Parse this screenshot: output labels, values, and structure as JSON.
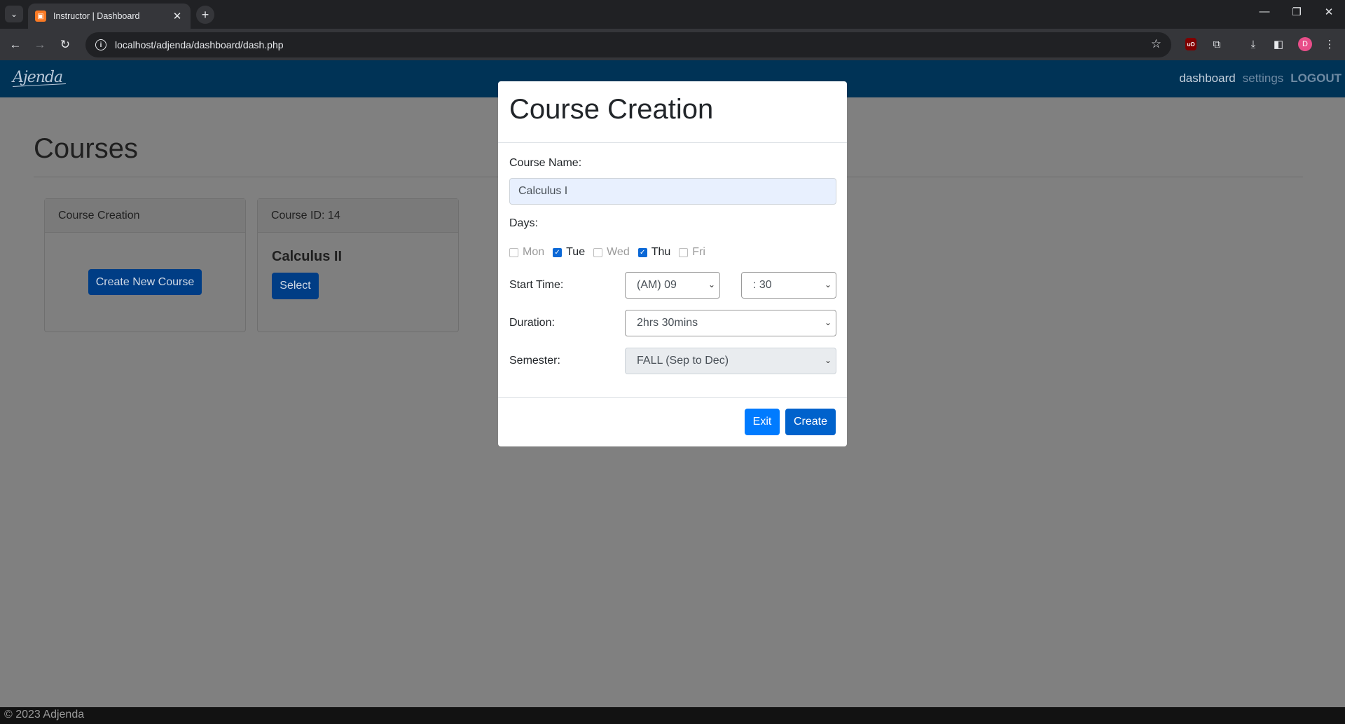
{
  "browser": {
    "tab_title": "Instructor | Dashboard",
    "url": "localhost/adjenda/dashboard/dash.php",
    "profile_initial": "D"
  },
  "site": {
    "logo": "Ajenda",
    "nav": {
      "dashboard": "dashboard",
      "settings": "settings",
      "logout": "LOGOUT"
    },
    "footer": "© 2023 Adjenda"
  },
  "main": {
    "heading": "Courses",
    "cards": [
      {
        "header": "Course Creation",
        "button": "Create New Course"
      },
      {
        "header": "Course ID: 14",
        "title": "Calculus II",
        "button": "Select"
      }
    ]
  },
  "modal": {
    "title": "Course Creation",
    "course_name_label": "Course Name:",
    "course_name_value": "Calculus I",
    "days_label": "Days:",
    "days": [
      {
        "label": "Mon",
        "checked": false
      },
      {
        "label": "Tue",
        "checked": true
      },
      {
        "label": "Wed",
        "checked": false
      },
      {
        "label": "Thu",
        "checked": true
      },
      {
        "label": "Fri",
        "checked": false
      }
    ],
    "start_time_label": "Start Time:",
    "start_hour": "(AM) 09",
    "start_minute": ": 30",
    "duration_label": "Duration:",
    "duration": "2hrs 30mins",
    "semester_label": "Semester:",
    "semester": "FALL (Sep to Dec)",
    "exit_button": "Exit",
    "create_button": "Create"
  },
  "colors": {
    "site_nav": "#003356",
    "primary": "#007bff",
    "overlay": "#808080"
  }
}
